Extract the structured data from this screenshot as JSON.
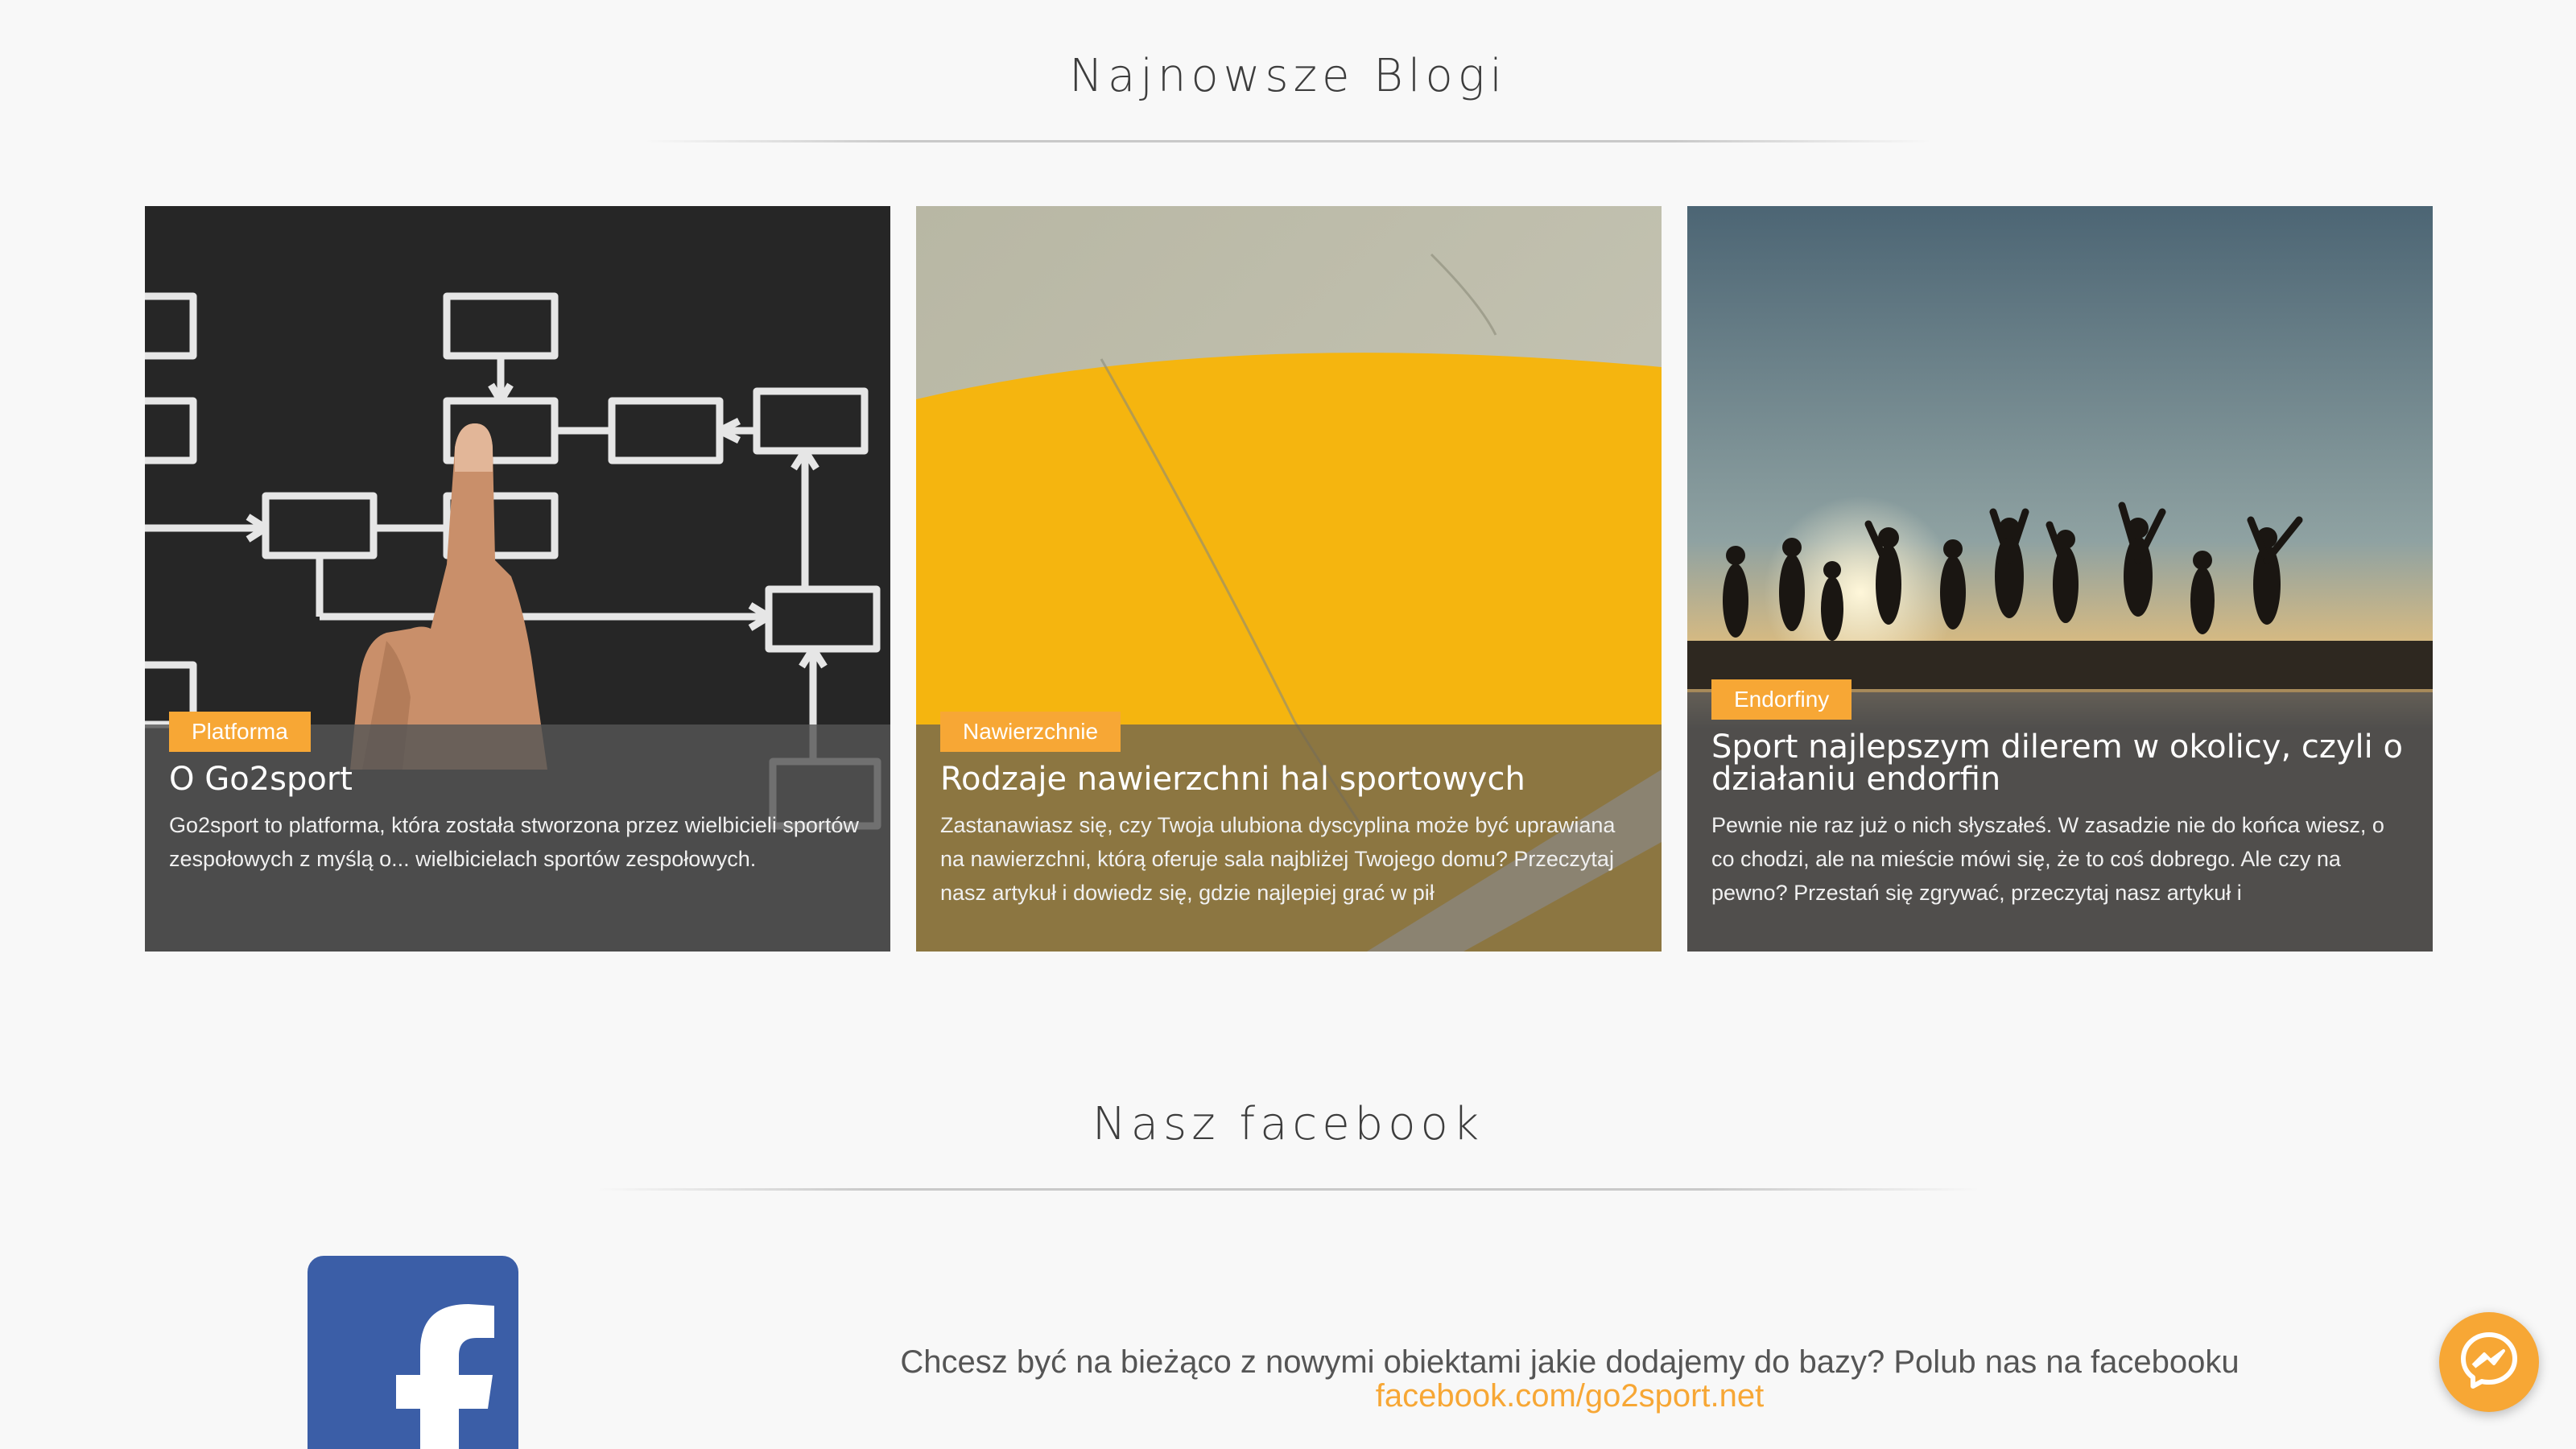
{
  "blogs": {
    "heading": "Najnowsze Blogi",
    "cards": [
      {
        "badge": "Platforma",
        "title": "O Go2sport",
        "text": "Go2sport to platforma, która została stworzona przez wielbicieli sportów zespołowych z myślą o... wielbicielach sportów zespołowych."
      },
      {
        "badge": "Nawierzchnie",
        "title": "Rodzaje nawierzchni hal sportowych",
        "text": "Zastanawiasz się, czy Twoja ulubiona dyscyplina może być uprawiana na nawierzchni, którą oferuje sala najbliżej Twojego domu? Przeczytaj nasz artykuł i dowiedz się, gdzie najlepiej grać w pił"
      },
      {
        "badge": "Endorfiny",
        "title": "Sport najlepszym dilerem w okolicy, czyli o działaniu endorfin",
        "text": "Pewnie nie raz już o nich słyszałeś. W zasadzie nie do końca wiesz, o co chodzi, ale na mieście mówi się, że to coś dobrego. Ale czy na pewno? Przestań się zgrywać, przeczytaj nasz artykuł i"
      }
    ]
  },
  "facebook": {
    "heading": "Nasz facebook",
    "text": "Chcesz być na bieżąco z nowymi obiektami jakie dodajemy do bazy? Polub nas na facebooku",
    "link": "facebook.com/go2sport.net"
  },
  "icons": {
    "facebook_logo": "facebook-logo",
    "messenger": "messenger-icon"
  },
  "colors": {
    "accent": "#f7a735",
    "facebook_blue": "#3b5ea7",
    "background": "#f8f8f8"
  }
}
